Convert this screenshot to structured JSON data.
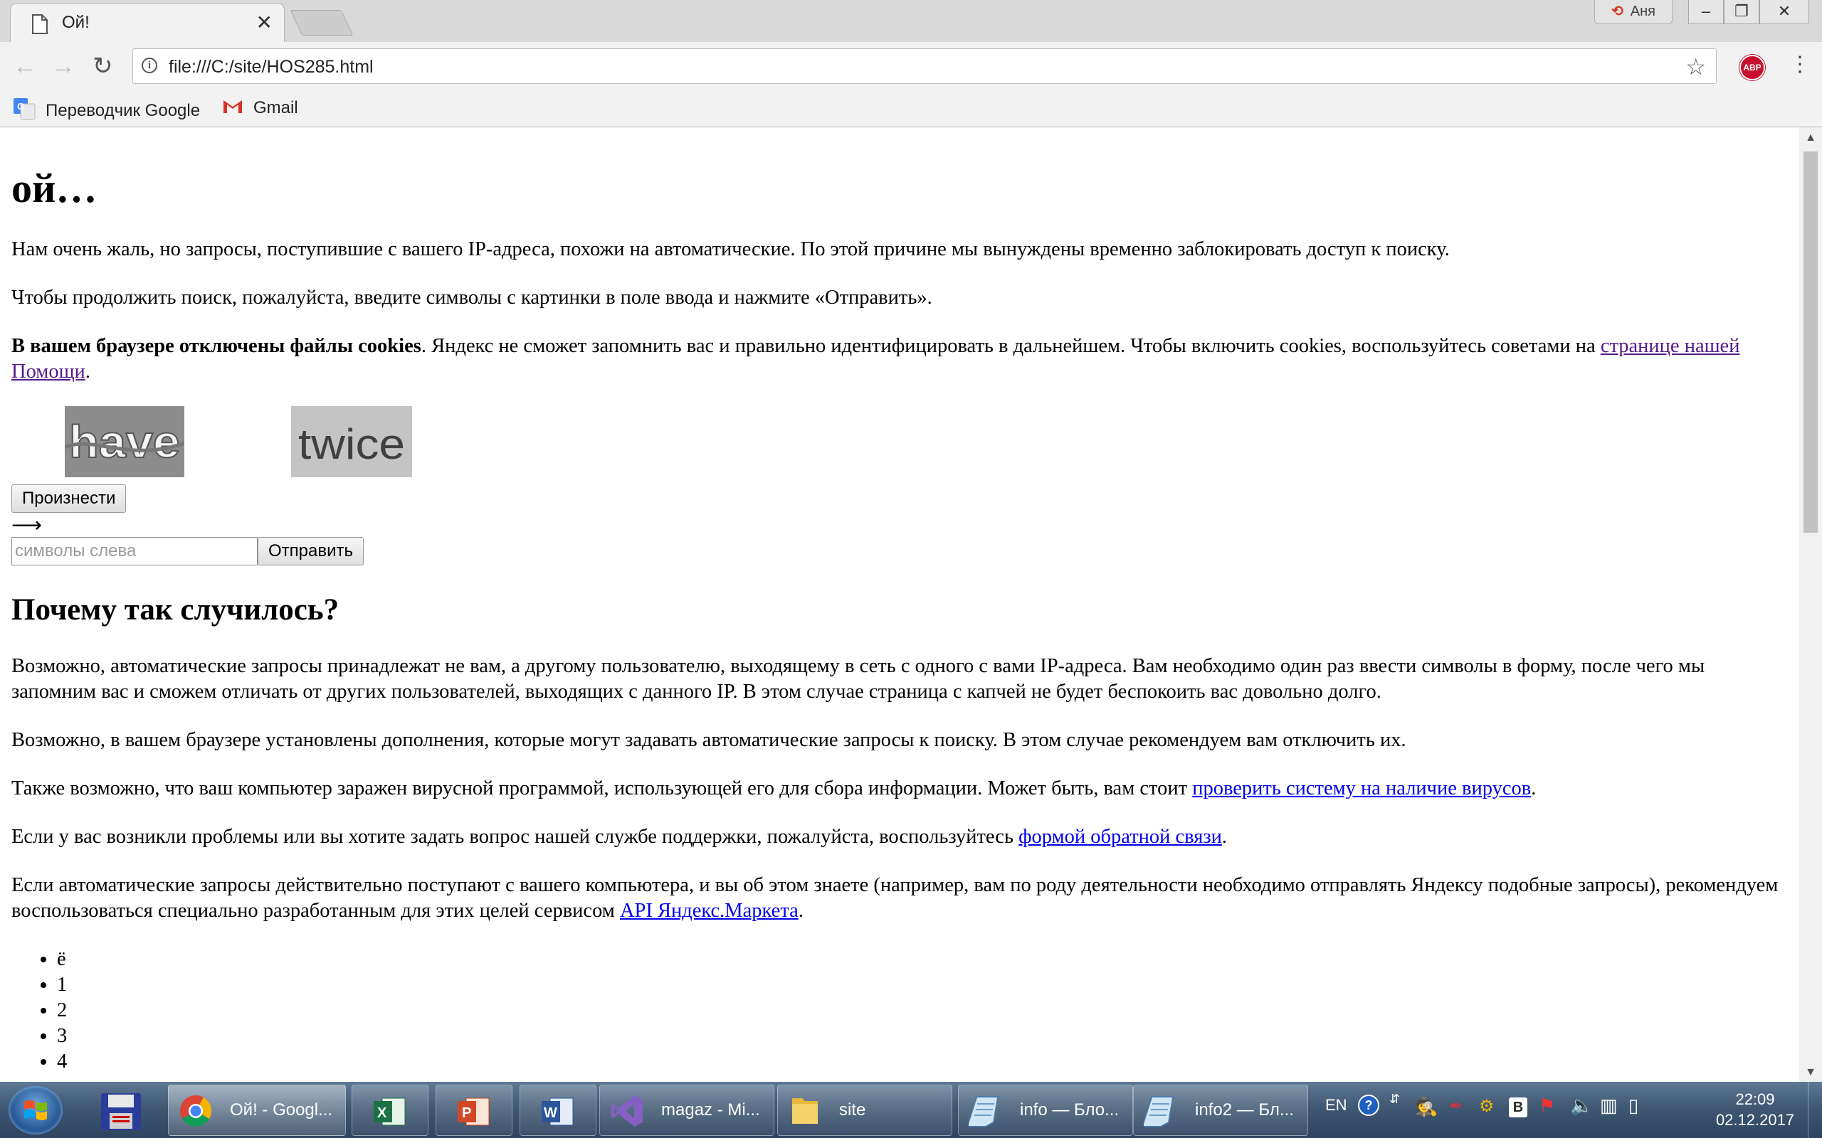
{
  "browser": {
    "tab_title": "Ой!",
    "tab_close": "✕",
    "profile_name": "Аня",
    "url": "file:///C:/site/HOS285.html",
    "abp_label": "ABP",
    "bookmarks": [
      {
        "label": "Переводчик Google",
        "icon": "google-translate-icon"
      },
      {
        "label": "Gmail",
        "icon": "gmail-icon"
      }
    ]
  },
  "page": {
    "title": "ой…",
    "p1": "Нам очень жаль, но запросы, поступившие с вашего IP-адреса, похожи на автоматические. По этой причине мы вынуждены временно заблокировать доступ к поиску.",
    "p2": "Чтобы продолжить поиск, пожалуйста, введите символы с картинки в поле ввода и нажмите «Отправить».",
    "cookies_bold": "В вашем браузере отключены файлы cookies",
    "cookies_text": ". Яндекс не сможет запомнить вас и правильно идентифицировать в дальнейшем. Чтобы включить cookies, воспользуйтесь советами на ",
    "cookies_link": "странице нашей Помощи",
    "cookies_end": ".",
    "captcha_word_1": "have",
    "captcha_word_2": "twice",
    "speak_button": "Произнести",
    "arrow": "⟶",
    "input_placeholder": "символы слева",
    "submit_button": "Отправить",
    "why_heading": "Почему так случилось?",
    "why_p1": "Возможно, автоматические запросы принадлежат не вам, а другому пользователю, выходящему в сеть с одного с вами IP-адреса. Вам необходимо один раз ввести символы в форму, после чего мы запомним вас и сможем отличать от других пользователей, выходящих с данного IP. В этом случае страница с капчей не будет беспокоить вас довольно долго.",
    "why_p2": "Возможно, в вашем браузере установлены дополнения, которые могут задавать автоматические запросы к поиску. В этом случае рекомендуем вам отключить их.",
    "why_p3_text": "Также возможно, что ваш компьютер заражен вирусной программой, использующей его для сбора информации. Может быть, вам стоит ",
    "why_p3_link": "проверить систему на наличие вирусов",
    "why_p3_end": ".",
    "why_p4_text": "Если у вас возникли проблемы или вы хотите задать вопрос нашей службе поддержки, пожалуйста, воспользуйтесь ",
    "why_p4_link": "формой обратной связи",
    "why_p4_end": ".",
    "why_p5_text": "Если автоматические запросы действительно поступают с вашего компьютера, и вы об этом знаете (например, вам по роду деятельности необходимо отправлять Яндексу подобные запросы), рекомендуем воспользоваться специально разработанным для этих целей сервисом ",
    "why_p5_link": "API Яндекс.Маркета",
    "why_p5_end": ".",
    "list": [
      "ё",
      "1",
      "2",
      "3",
      "4"
    ]
  },
  "taskbar": {
    "items": [
      {
        "label": "Ой! - Googl...",
        "icon": "chrome-icon"
      },
      {
        "label": "",
        "icon": "excel-icon"
      },
      {
        "label": "",
        "icon": "powerpoint-icon"
      },
      {
        "label": "",
        "icon": "word-icon"
      },
      {
        "label": "magaz - Mi...",
        "icon": "visual-studio-icon"
      },
      {
        "label": "site",
        "icon": "folder-icon"
      },
      {
        "label": "info — Бло...",
        "icon": "notepad-icon"
      },
      {
        "label": "info2 — Бл...",
        "icon": "notepad-icon"
      }
    ],
    "language": "EN",
    "time": "22:09",
    "date": "02.12.2017"
  },
  "colors": {
    "link": "#0000ee",
    "visited_link": "#551a8b",
    "taskbar": "#3f5873"
  }
}
